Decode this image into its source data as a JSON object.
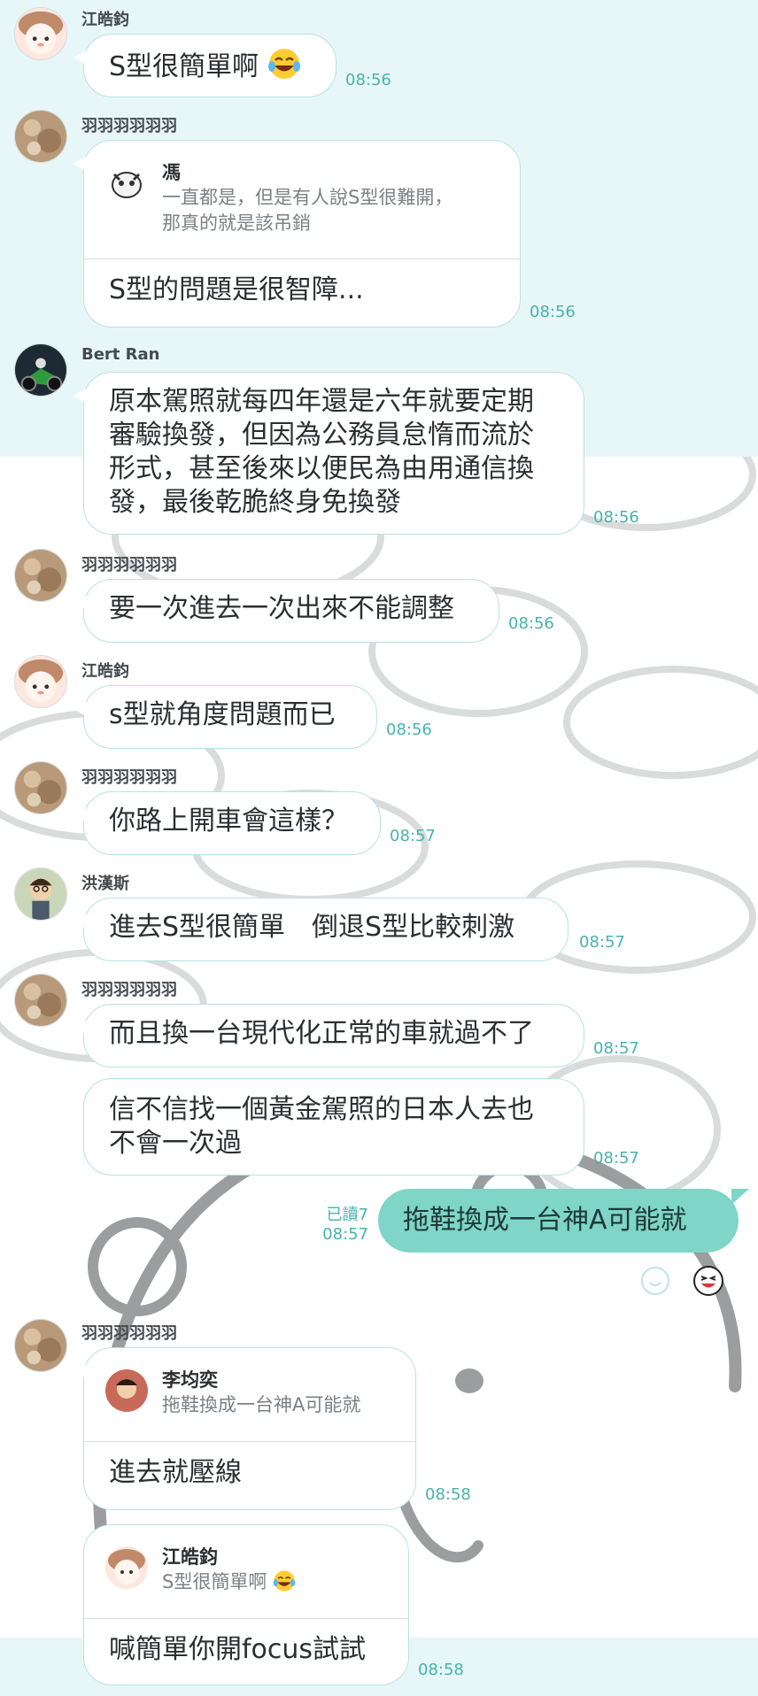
{
  "messages": {
    "m1": {
      "sender": "江皓鈞",
      "text": "S型很簡單啊",
      "time": "08:56"
    },
    "m2": {
      "sender": "羽羽羽羽羽羽",
      "quote_name": "馮",
      "quote_line1": "一直都是，但是有人說S型很難開，",
      "quote_line2": "那真的就是該吊銷",
      "text": "S型的問題是很智障...",
      "time": "08:56"
    },
    "m3": {
      "sender": "Bert Ran",
      "line1": "原本駕照就每四年還是六年就要定期",
      "line2": "審驗換發，但因為公務員怠惰而流於",
      "line3": "形式，甚至後來以便民為由用通信換",
      "line4": "發，最後乾脆終身免換發",
      "time": "08:56"
    },
    "m4": {
      "sender": "羽羽羽羽羽羽",
      "text": "要一次進去一次出來不能調整",
      "time": "08:56"
    },
    "m5": {
      "sender": "江皓鈞",
      "text": "s型就角度問題而已",
      "time": "08:56"
    },
    "m6": {
      "sender": "羽羽羽羽羽羽",
      "text": "你路上開車會這樣？",
      "time": "08:57"
    },
    "m7": {
      "sender": "洪漢斯",
      "text": "進去S型很簡單　倒退S型比較刺激",
      "time": "08:57"
    },
    "m8": {
      "sender": "羽羽羽羽羽羽",
      "text": "而且換一台現代化正常的車就過不了",
      "time": "08:57"
    },
    "m9": {
      "line1": "信不信找一個黃金駕照的日本人去也",
      "line2": "不會一次過",
      "time": "08:57"
    },
    "m10": {
      "read": "已讀7",
      "time": "08:57",
      "text": "拖鞋換成一台神A可能就"
    },
    "m11": {
      "sender": "羽羽羽羽羽羽",
      "quote_name": "李均奕",
      "quote_text": "拖鞋換成一台神A可能就",
      "text": "進去就壓線",
      "time": "08:58"
    },
    "m12": {
      "quote_name": "江皓鈞",
      "quote_text": "S型很簡單啊",
      "text": "喊簡單你開focus試試",
      "time": "08:58"
    }
  },
  "icons": {
    "laugh_emoji": "face-with-tears-of-joy-icon",
    "reaction_add": "add-reaction-icon",
    "reaction_face": "grinning-face-reaction-icon"
  },
  "colors": {
    "accent": "#46b3ad",
    "my_bubble": "#7ed5c8",
    "bubble_border": "#b9e2e3",
    "background": "#e7f7f8"
  }
}
